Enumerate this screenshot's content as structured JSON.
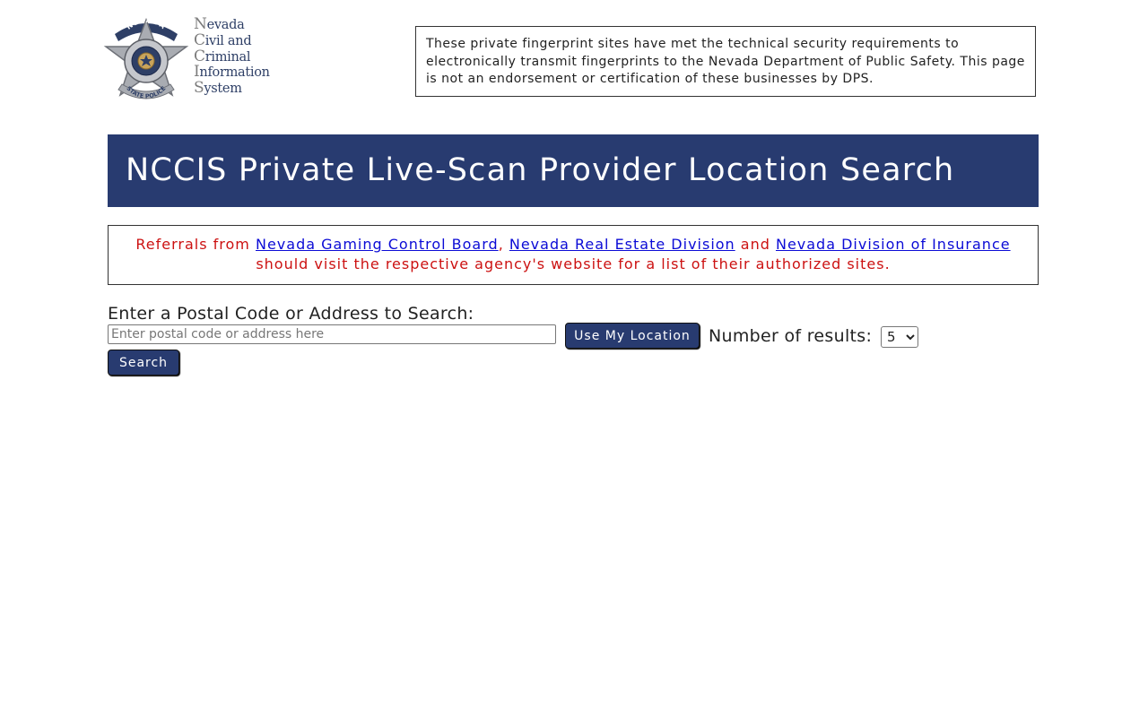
{
  "logo": {
    "badge_top_text": "NEVADA",
    "badge_bottom_text": "STATE POLICE",
    "text_lines": [
      {
        "cap": "N",
        "rest": "evada"
      },
      {
        "cap": "C",
        "rest": "ivil and"
      },
      {
        "cap": "C",
        "rest": "riminal"
      },
      {
        "cap": "I",
        "rest": "nformation"
      },
      {
        "cap": "S",
        "rest": "ystem"
      }
    ],
    "badge_icon": "star-badge-icon"
  },
  "disclaimer": "These private fingerprint sites have met the technical security requirements to electronically transmit fingerprints to the Nevada Department of Public Safety. This page is not an endorsement or certification of these businesses by DPS.",
  "page_title": "NCCIS Private Live-Scan Provider Location Search",
  "referral": {
    "prefix": "Referrals from ",
    "link_gaming": "Nevada Gaming Control Board",
    "sep1": ", ",
    "link_real_estate": "Nevada Real Estate Division",
    "sep2": " and ",
    "link_insurance": "Nevada Division of Insurance",
    "suffix": "should visit the respective agency's website for a list of their authorized sites."
  },
  "search": {
    "label": "Enter a Postal Code or Address to Search:",
    "placeholder": "Enter postal code or address here",
    "value": "",
    "location_button": "Use My Location",
    "search_button": "Search",
    "results_label": "Number of results:",
    "results_selected": "5"
  },
  "colors": {
    "banner": "#283b70",
    "referral_text": "#cc1111",
    "link": "#0b0bd6",
    "badge_blue": "#2e3f66",
    "badge_silver": "#a9acb2"
  }
}
